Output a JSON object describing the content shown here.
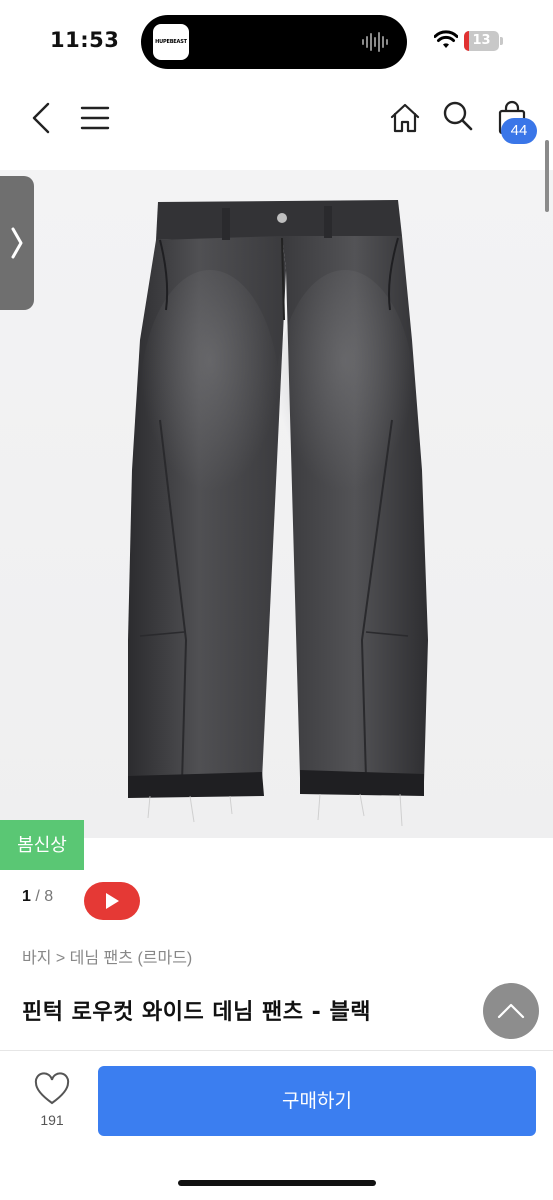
{
  "status_bar": {
    "time": "11:53",
    "island_app_label": "HUPEBEAST",
    "battery_level": "13",
    "battery_fraction": 0.13,
    "battery_fill_color": "#e03131"
  },
  "nav": {
    "icons": [
      "chevron-left-icon",
      "menu-icon",
      "home-icon",
      "search-icon",
      "shopping-bag-icon"
    ],
    "cart_count": "44",
    "badge_color": "#3a76e8"
  },
  "product": {
    "new_badge": "봄신상",
    "new_badge_color": "#5ac774",
    "image_current": "1",
    "image_separator": " / ",
    "image_total": "8",
    "video_button_color": "#e53935",
    "breadcrumb": "바지 > 데님 팬츠 (르마드)",
    "title": "핀턱 로우컷 와이드 데님 팬츠 - 블랙"
  },
  "bottom_bar": {
    "like_count": "191",
    "buy_label": "구매하기",
    "buy_color": "#3b7ef0"
  }
}
